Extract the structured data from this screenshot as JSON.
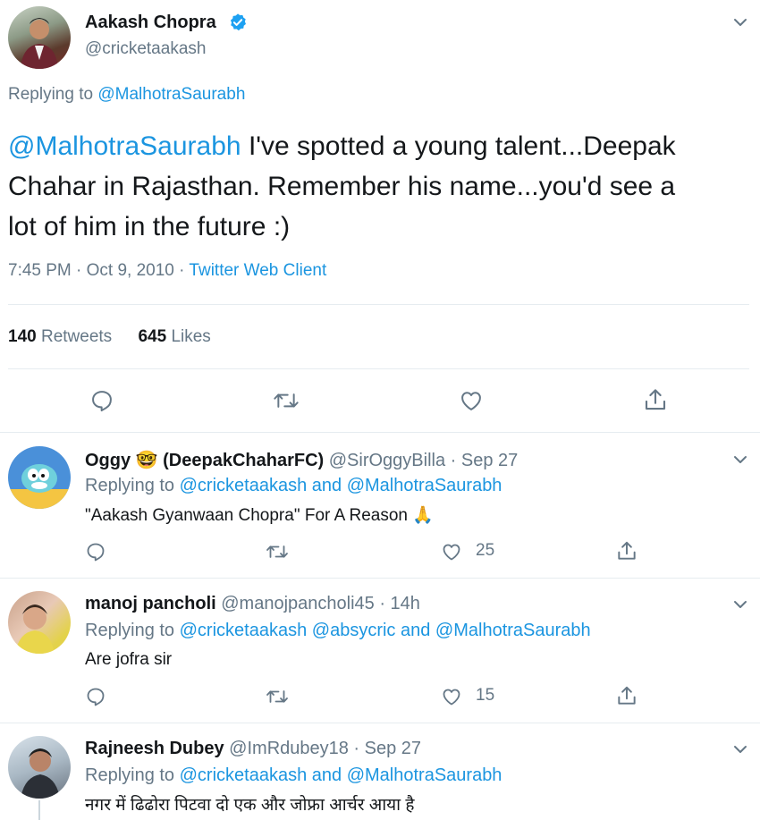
{
  "main_tweet": {
    "author_name": "Aakash Chopra",
    "author_handle": "@cricketaakash",
    "replying_prefix": "Replying to",
    "replying_to": "@MalhotraSaurabh",
    "text_mention": "@MalhotraSaurabh",
    "text_line1": "I've spotted a young talent...Deepak",
    "text_line2": "Chahar in Rajasthan. Remember his name...you'd see a",
    "text_line3": "lot of him in the future :)",
    "time": "7:45 PM · Oct 9, 2010 · ",
    "source": "Twitter Web Client",
    "retweets_count": "140",
    "retweets_label": "Retweets",
    "likes_count": "645",
    "likes_label": "Likes"
  },
  "replies": [
    {
      "name": "Oggy 🤓 (DeepakChaharFC)",
      "handle_time": "@SirOggyBilla · Sep 27",
      "replying_prefix": "Replying to",
      "replying_to_1": "@cricketaakash",
      "replying_and": "and",
      "replying_to_2": "@MalhotraSaurabh",
      "text": "\"Aakash Gyanwaan Chopra\" For A Reason 🙏",
      "likes": "25"
    },
    {
      "name": "manoj pancholi",
      "handle_time": "@manojpancholi45 · 14h",
      "replying_prefix": "Replying to",
      "replying_to_1": "@cricketaakash",
      "replying_to_2": "@absycric",
      "replying_and": "and",
      "replying_to_3": "@MalhotraSaurabh",
      "text": "Are jofra sir",
      "likes": "15"
    },
    {
      "name": "Rajneesh Dubey",
      "handle_time": "@ImRdubey18 · Sep 27",
      "replying_prefix": "Replying to",
      "replying_to_1": "@cricketaakash",
      "replying_and": "and",
      "replying_to_2": "@MalhotraSaurabh",
      "text": "नगर में ढिढोरा पिटवा दो एक और जोफ्रा आर्चर आया है"
    }
  ],
  "colors": {
    "link": "#1b95e0",
    "muted": "#657786",
    "verified": "#1da1f2",
    "divider": "#e6ecf0"
  }
}
